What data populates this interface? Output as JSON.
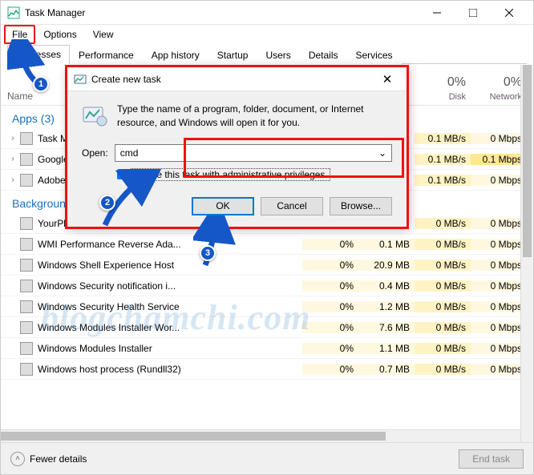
{
  "window": {
    "title": "Task Manager"
  },
  "menu": {
    "file": "File",
    "options": "Options",
    "view": "View"
  },
  "tabs": {
    "processes": "Processes",
    "performance": "Performance",
    "app_history": "App history",
    "startup": "Startup",
    "users": "Users",
    "details": "Details",
    "services": "Services"
  },
  "columns": {
    "name": "Name",
    "cpu": {
      "pct": "",
      "lbl": ""
    },
    "mem": {
      "pct": "",
      "lbl": ""
    },
    "disk": {
      "pct": "0%",
      "lbl": "Disk"
    },
    "network": {
      "pct": "0%",
      "lbl": "Network"
    }
  },
  "groups": {
    "apps": {
      "label": "Apps (3)",
      "rows": [
        {
          "name": "Task Man",
          "cpu": "",
          "mem": "",
          "disk": "0.1 MB/s",
          "net": "0 Mbps"
        },
        {
          "name": "Google",
          "cpu": "",
          "mem": "",
          "disk": "0.1 MB/s",
          "net": "0.1 Mbps",
          "net_hl": true
        },
        {
          "name": "Adobe",
          "cpu": "",
          "mem": "",
          "disk": "0.1 MB/s",
          "net": "0 Mbps"
        }
      ]
    },
    "background": {
      "label": "Background",
      "rows": [
        {
          "name": "YourPhon",
          "cpu": "",
          "mem": "",
          "disk": "0 MB/s",
          "net": "0 Mbps"
        },
        {
          "name": "WMI Performance Reverse Ada...",
          "cpu": "0%",
          "mem": "0.1 MB",
          "disk": "0 MB/s",
          "net": "0 Mbps"
        },
        {
          "name": "Windows Shell Experience Host",
          "cpu": "0%",
          "mem": "20.9 MB",
          "disk": "0 MB/s",
          "net": "0 Mbps"
        },
        {
          "name": "Windows Security notification i...",
          "cpu": "0%",
          "mem": "0.4 MB",
          "disk": "0 MB/s",
          "net": "0 Mbps"
        },
        {
          "name": "Windows Security Health Service",
          "cpu": "0%",
          "mem": "1.2 MB",
          "disk": "0 MB/s",
          "net": "0 Mbps"
        },
        {
          "name": "Windows Modules Installer Wor...",
          "cpu": "0%",
          "mem": "7.6 MB",
          "disk": "0 MB/s",
          "net": "0 Mbps"
        },
        {
          "name": "Windows Modules Installer",
          "cpu": "0%",
          "mem": "1.1 MB",
          "disk": "0 MB/s",
          "net": "0 Mbps"
        },
        {
          "name": "Windows host process (Rundll32)",
          "cpu": "0%",
          "mem": "0.7 MB",
          "disk": "0 MB/s",
          "net": "0 Mbps"
        }
      ]
    }
  },
  "footer": {
    "fewer": "Fewer details",
    "end_task": "End task"
  },
  "dialog": {
    "title": "Create new task",
    "message": "Type the name of a program, folder, document, or Internet resource, and Windows will open it for you.",
    "open_label": "Open:",
    "open_value": "cmd",
    "checkbox_label": "Create this task with administrative privileges.",
    "ok": "OK",
    "cancel": "Cancel",
    "browse": "Browse..."
  },
  "annotations": {
    "n1": "1",
    "n2": "2",
    "n3": "3"
  },
  "watermark": "blogchamchi.com"
}
